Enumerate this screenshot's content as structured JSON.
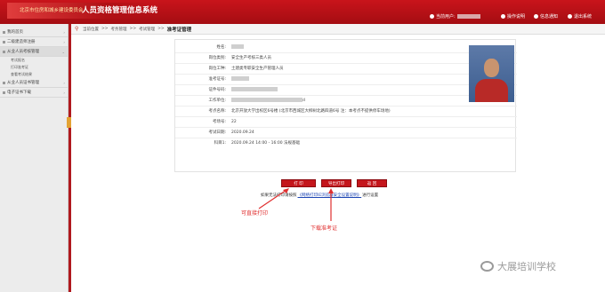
{
  "header": {
    "org": "北京市住房和城乡建设委员会",
    "title": "人员资格管理信息系统",
    "user_label": "当前用户:",
    "menu": [
      "操作说明",
      "信息通知",
      "退出系统"
    ]
  },
  "sidebar": {
    "items": [
      {
        "label": "我的首页"
      },
      {
        "label": "二级建造师注册"
      },
      {
        "label": "从业人员考核管理",
        "active": true
      }
    ],
    "subitems": [
      "考试报名",
      "打印准考证",
      "查看考试结果"
    ],
    "items2": [
      {
        "label": "从业人员证书管理"
      },
      {
        "label": "电子证书下载"
      }
    ]
  },
  "breadcrumb": {
    "path": [
      "当前位置",
      ">>",
      "考务管理",
      ">>",
      "考试管理",
      ">>"
    ],
    "current": "准考证管理"
  },
  "ticket": {
    "rows": [
      {
        "label": "姓名:",
        "value": ""
      },
      {
        "label": "岗位类别:",
        "value": "安全生产考核三类人员"
      },
      {
        "label": "岗位工种:",
        "value": "土建类专职安全生产管理人员"
      },
      {
        "label": "准考证号:",
        "value": ""
      },
      {
        "label": "证件号码:",
        "value": ""
      },
      {
        "label": "工作单位:",
        "value": "d"
      },
      {
        "label": "考点名称:",
        "value": "北京开放大学出校区6号楼 (北京市西城区大柳树北路四道6号 注：本考点不提供停车场地)"
      },
      {
        "label": "考场号:",
        "value": "22"
      },
      {
        "label": "考试日期:",
        "value": "2020.09.24"
      },
      {
        "label": "科目1:",
        "value": "2020.09.24 14:00 - 16:00 法规基础"
      }
    ]
  },
  "buttons": {
    "print": "打 印",
    "download": "导出打印",
    "back": "返 回"
  },
  "notice": {
    "prefix": "如果无法打印请按照",
    "link": "《网络打印IE浏览器安全设置说明》",
    "suffix": "进行设置"
  },
  "annotations": {
    "direct_print": "可直接打印",
    "download_ticket": "下载准考证"
  },
  "watermark": "大展培训学校",
  "colors": {
    "brand_red": "#c4161c",
    "link": "#1e46b4",
    "annotation": "#e03030"
  }
}
